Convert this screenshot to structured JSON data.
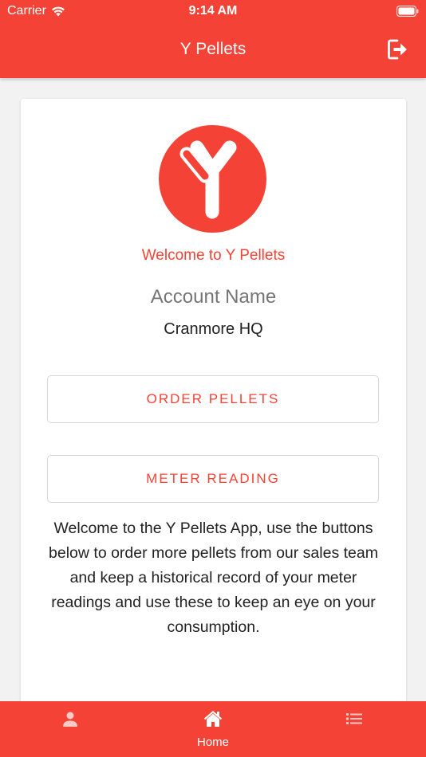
{
  "status_bar": {
    "carrier": "Carrier",
    "time": "9:14 AM"
  },
  "appbar": {
    "title": "Y Pellets",
    "logout_icon": "logout-icon"
  },
  "card": {
    "logo_icon": "y-pellets-logo",
    "welcome": "Welcome to Y Pellets",
    "account_heading": "Account Name",
    "account_name": "Cranmore HQ",
    "order_button": "ORDER PELLETS",
    "meter_button": "METER READING",
    "intro": "Welcome to the Y Pellets App, use the buttons below to order more pellets from our sales team and keep a historical record of your meter readings and use these to keep an eye on your consumption."
  },
  "bottom_nav": {
    "items": [
      {
        "icon": "person-icon",
        "label": "",
        "active": false
      },
      {
        "icon": "home-icon",
        "label": "Home",
        "active": true
      },
      {
        "icon": "list-icon",
        "label": "",
        "active": false
      }
    ]
  },
  "colors": {
    "accent": "#f44336",
    "background": "#f2f2f2",
    "card": "#ffffff"
  }
}
